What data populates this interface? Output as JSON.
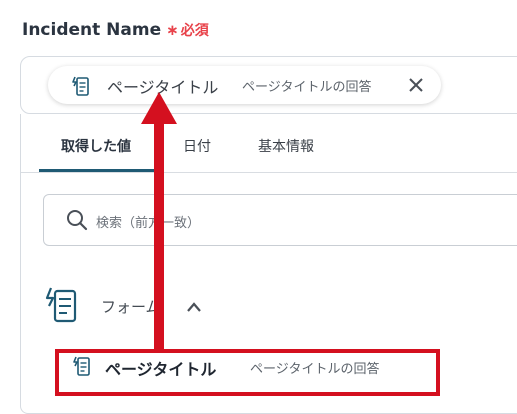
{
  "field": {
    "label": "Incident Name",
    "required_mark": "∗",
    "required_text": "必須",
    "chip": {
      "title": "ページタイトル",
      "subtitle": "ページタイトルの回答",
      "icon": "form-icon",
      "close_icon": "close-icon"
    }
  },
  "tabs": [
    {
      "label": "取得した値",
      "active": true
    },
    {
      "label": "日付",
      "active": false
    },
    {
      "label": "基本情報",
      "active": false
    }
  ],
  "search": {
    "placeholder": "検索（前方一致）",
    "icon": "search-icon"
  },
  "group": {
    "label": "フォーム",
    "icon": "form-icon",
    "chevron": "chevron-up-icon"
  },
  "item": {
    "title": "ページタイトル",
    "subtitle": "ページタイトルの回答",
    "icon": "form-icon"
  },
  "colors": {
    "required": "#e8424a",
    "tab_underline": "#1f5a74",
    "annotation": "#d4101f",
    "icon": "#1f5a74"
  }
}
